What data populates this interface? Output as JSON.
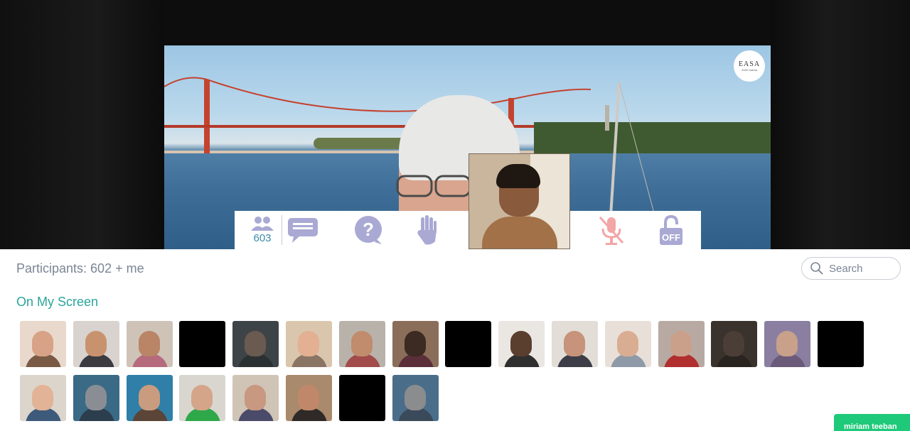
{
  "controls": {
    "participant_count": "603",
    "lock_label": "OFF"
  },
  "logo": {
    "line1": "EASA",
    "line2": "2020 Lisboa"
  },
  "panel": {
    "participants_text": "Participants: 602 + me",
    "search_placeholder": "Search",
    "section_title": "On My Screen"
  },
  "toast": {
    "label": "miriam teeban"
  },
  "colors": {
    "accent_teal": "#2aa59a",
    "count_blue": "#3a8ca8",
    "icon_lavender": "#a9a9d4",
    "mic_muted": "#f2a6a6",
    "toast_green": "#1ec97a"
  },
  "tiles": [
    {
      "name": "participant-1",
      "bg": "#e9d9cc",
      "face": "#d8a287",
      "body": "#7a5a45"
    },
    {
      "name": "participant-2",
      "bg": "#d8d3cf",
      "face": "#c9926f",
      "body": "#3b3b40"
    },
    {
      "name": "participant-3",
      "bg": "#cfc3b8",
      "face": "#b98566",
      "body": "#b56a7d"
    },
    {
      "name": "participant-4",
      "bg": "#000000",
      "face": "#000000",
      "body": "#000000"
    },
    {
      "name": "participant-5",
      "bg": "#3d4448",
      "face": "#6b5a50",
      "body": "#2b3033"
    },
    {
      "name": "participant-6",
      "bg": "#d9c6ad",
      "face": "#e3b093",
      "body": "#8a7565"
    },
    {
      "name": "participant-7",
      "bg": "#b9b2aa",
      "face": "#c08c6d",
      "body": "#a14b4b"
    },
    {
      "name": "participant-8",
      "bg": "#8a6e5a",
      "face": "#3b2b22",
      "body": "#5a2f3a"
    },
    {
      "name": "participant-9",
      "bg": "#000000",
      "face": "#000000",
      "body": "#000000"
    },
    {
      "name": "participant-10",
      "bg": "#eae7e2",
      "face": "#5b3f2e",
      "body": "#2f2f2f"
    },
    {
      "name": "participant-11",
      "bg": "#e2ddd7",
      "face": "#c7937a",
      "body": "#3d3d47"
    },
    {
      "name": "participant-12",
      "bg": "#e8e0d8",
      "face": "#d9ad92",
      "body": "#8f9aa8"
    },
    {
      "name": "participant-13",
      "bg": "#b8aaa2",
      "face": "#caa08a",
      "body": "#b12f2f"
    },
    {
      "name": "participant-14",
      "bg": "#3a322d",
      "face": "#4a3e36",
      "body": "#2a2420"
    },
    {
      "name": "participant-15",
      "bg": "#8a7fa0",
      "face": "#c9a08a",
      "body": "#6b5a7a"
    },
    {
      "name": "participant-16",
      "bg": "#000000",
      "face": "#000000",
      "body": "#000000"
    },
    {
      "name": "participant-17",
      "bg": "#dcd5cc",
      "face": "#e2b396",
      "body": "#3e5a7a"
    },
    {
      "name": "participant-18",
      "bg": "#3a6a86",
      "face": "#8a8e94",
      "body": "#2c3e4e"
    },
    {
      "name": "participant-19",
      "bg": "#2f7fa8",
      "face": "#c99c80",
      "body": "#5a4538"
    },
    {
      "name": "participant-20",
      "bg": "#d9d6cf",
      "face": "#d5a58a",
      "body": "#2fa84a"
    },
    {
      "name": "participant-21",
      "bg": "#cfc4b6",
      "face": "#c99880",
      "body": "#4a4a6a"
    },
    {
      "name": "participant-22",
      "bg": "#a98a6c",
      "face": "#c0876a",
      "body": "#2f2a27"
    },
    {
      "name": "participant-23",
      "bg": "#000000",
      "face": "#000000",
      "body": "#000000"
    },
    {
      "name": "participant-24",
      "bg": "#4a6e8a",
      "face": "#8b8c8e",
      "body": "#3a4a5a"
    }
  ]
}
